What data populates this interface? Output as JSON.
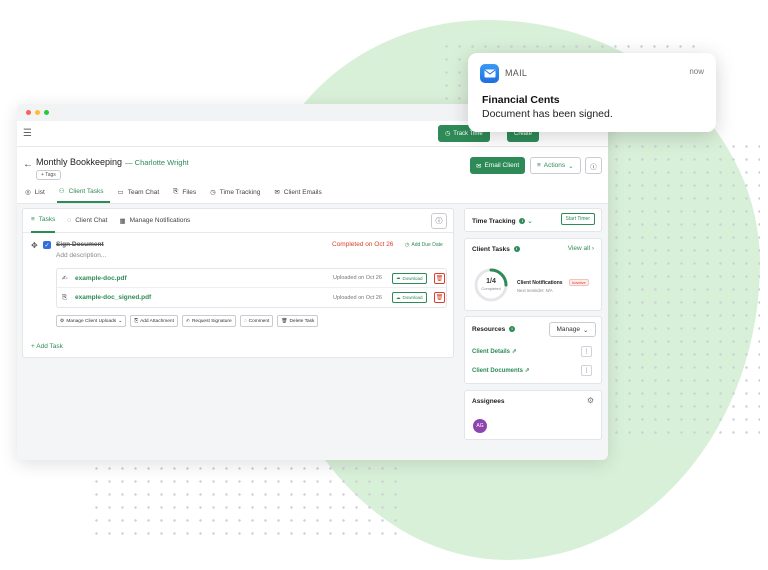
{
  "notification": {
    "app": "MAIL",
    "time": "now",
    "title": "Financial Cents",
    "body": "Document has been signed."
  },
  "topbar": {
    "track_time_label": "Track Time",
    "create_label": "Create"
  },
  "header": {
    "title": "Monthly Bookkeeping",
    "client": "— Charlotte Wright",
    "tags_label": "+ Tags",
    "email_client_label": "Email Client",
    "actions_label": "Actions"
  },
  "nav": {
    "list": "List",
    "client_tasks": "Client Tasks",
    "team_chat": "Team Chat",
    "files": "Files",
    "time_tracking": "Time Tracking",
    "client_emails": "Client Emails"
  },
  "subtabs": {
    "tasks": "Tasks",
    "client_chat": "Client Chat",
    "manage_notifications": "Manage Notifications"
  },
  "task": {
    "name": "Sign Document",
    "description": "Add description...",
    "status": "Completed on Oct 26",
    "add_due_date": "Add Due Date",
    "files": [
      {
        "name": "example-doc.pdf",
        "uploaded": "Uploaded on Oct 26",
        "download": "Download"
      },
      {
        "name": "example-doc_signed.pdf",
        "uploaded": "Uploaded on Oct 26",
        "download": "Download"
      }
    ],
    "actions": {
      "manage_uploads": "Manage Client Uploads",
      "add_attachment": "Add Attachment",
      "request_signature": "Request Signature",
      "comment": "Comment",
      "delete_task": "Delete Task"
    }
  },
  "add_task_label": "+ Add Task",
  "time_tracking": {
    "title": "Time Tracking",
    "start_timer": "Start Timer"
  },
  "client_tasks": {
    "title": "Client Tasks",
    "view_all": "View all",
    "progress_value": "1/4",
    "progress_label": "Completed",
    "progress_fraction": 0.25,
    "notif_title": "Client Notifications",
    "notif_status": "Inactive",
    "notif_sub": "Next reminder: N/A"
  },
  "resources": {
    "title": "Resources",
    "manage_label": "Manage",
    "items": [
      "Client Details",
      "Client Documents"
    ]
  },
  "assignees": {
    "title": "Assignees",
    "avatar_initials": "AG"
  },
  "colors": {
    "brand_green": "#2e8b57",
    "danger_red": "#d9402b",
    "blob_green": "#d9f0d8"
  }
}
